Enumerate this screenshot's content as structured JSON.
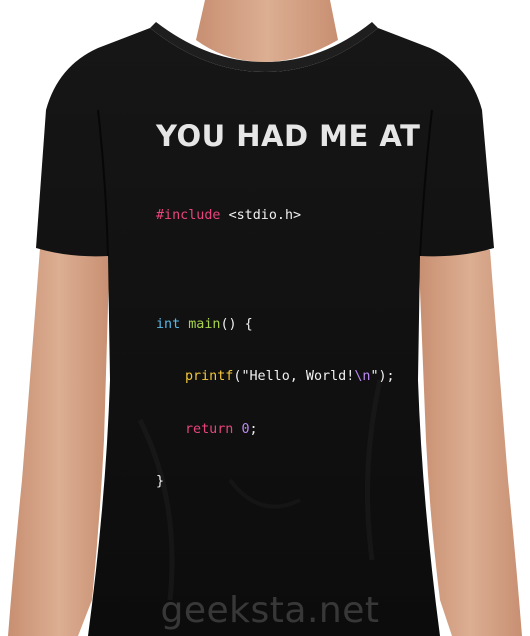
{
  "shirt": {
    "headline": "YOU HAD ME AT",
    "code": {
      "include_directive": "#include",
      "include_header": "<stdio.h>",
      "type_keyword": "int",
      "function_name": "main",
      "function_signature_rest": "() {",
      "printf_name": "printf",
      "printf_open": "(",
      "printf_string": "\"Hello, World!",
      "printf_escape": "\\n",
      "printf_string_end": "\"",
      "printf_close": ");",
      "return_keyword": "return",
      "return_value": "0",
      "return_semicolon": ";",
      "closing_brace": "}"
    }
  },
  "watermark": "geeksta.net",
  "colors": {
    "background": "#ffffff",
    "shirt": "#111111",
    "skin": "#d7a386",
    "headline": "#e6e6e6",
    "preprocessor": "#e8457a",
    "keyword_type": "#59b8e6",
    "function": "#a7d44c",
    "printf": "#f0c53b",
    "string": "#f0f0f0",
    "escape": "#b889f0",
    "return_keyword": "#e8457a",
    "number": "#b889f0"
  }
}
